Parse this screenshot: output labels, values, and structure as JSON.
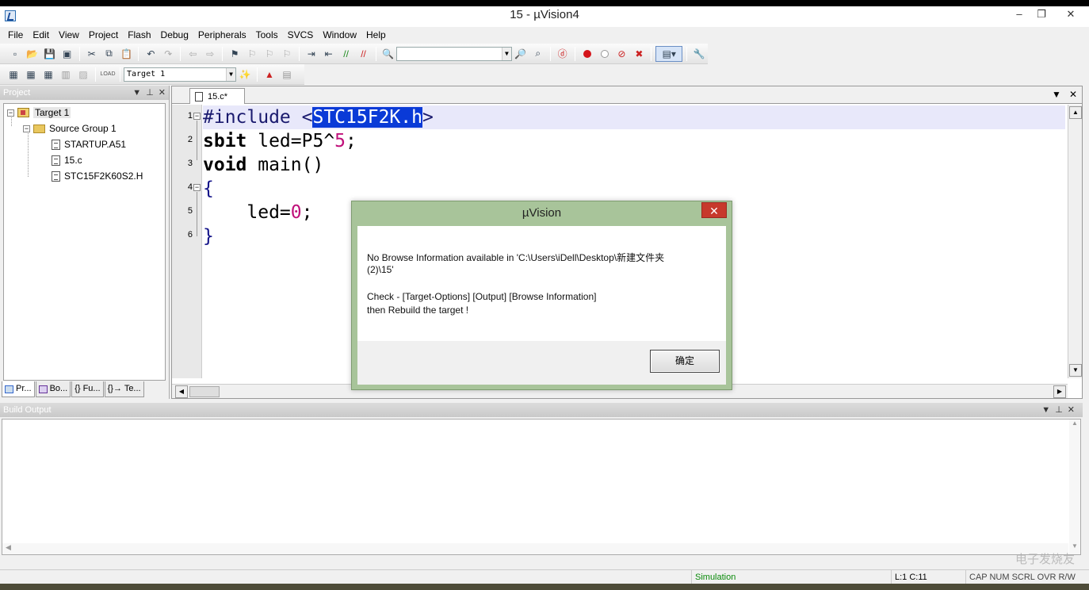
{
  "window": {
    "title": "15  - µVision4",
    "minimize": "–",
    "maximize": "❐",
    "close": "✕"
  },
  "menu": [
    "File",
    "Edit",
    "View",
    "Project",
    "Flash",
    "Debug",
    "Peripherals",
    "Tools",
    "SVCS",
    "Window",
    "Help"
  ],
  "toolbar": {
    "find_combo_value": "",
    "target_combo_value": "Target 1",
    "load_label": "LOAD"
  },
  "project_panel": {
    "title": "Project",
    "tree": {
      "target": "Target 1",
      "group": "Source Group 1",
      "files": [
        "STARTUP.A51",
        "15.c",
        "STC15F2K60S2.H"
      ]
    },
    "tabs": [
      "Pr...",
      "Bo...",
      "{} Fu...",
      "{}→ Te..."
    ]
  },
  "editor": {
    "tab": "15.c*",
    "line_numbers": [
      "1",
      "2",
      "3",
      "4",
      "5",
      "6"
    ],
    "lines": {
      "l1_pre": "#include <",
      "l1_sel": "STC15F2K.h",
      "l1_post": ">",
      "l2_kw": "sbit",
      "l2_text": " led=P5^",
      "l2_num": "5",
      "l2_end": ";",
      "l3_kw": "void",
      "l3_text": " main()",
      "l4": "{",
      "l5_text": "    led=",
      "l5_num": "0",
      "l5_end": ";",
      "l6": "}"
    }
  },
  "build_output": {
    "title": "Build Output",
    "content": ""
  },
  "status": {
    "mode": "Simulation",
    "position": "L:1 C:11",
    "flags": "CAP NUM SCRL OVR R/W"
  },
  "dialog": {
    "title": "µVision",
    "close": "✕",
    "line1": "No Browse Information available in 'C:\\Users\\iDell\\Desktop\\新建文件夹",
    "line2": "(2)\\15'",
    "line3": "Check - [Target-Options] [Output] [Browse Information]",
    "line4": "then Rebuild the target !",
    "ok_button": "确定"
  },
  "watermark": "电子发烧友"
}
